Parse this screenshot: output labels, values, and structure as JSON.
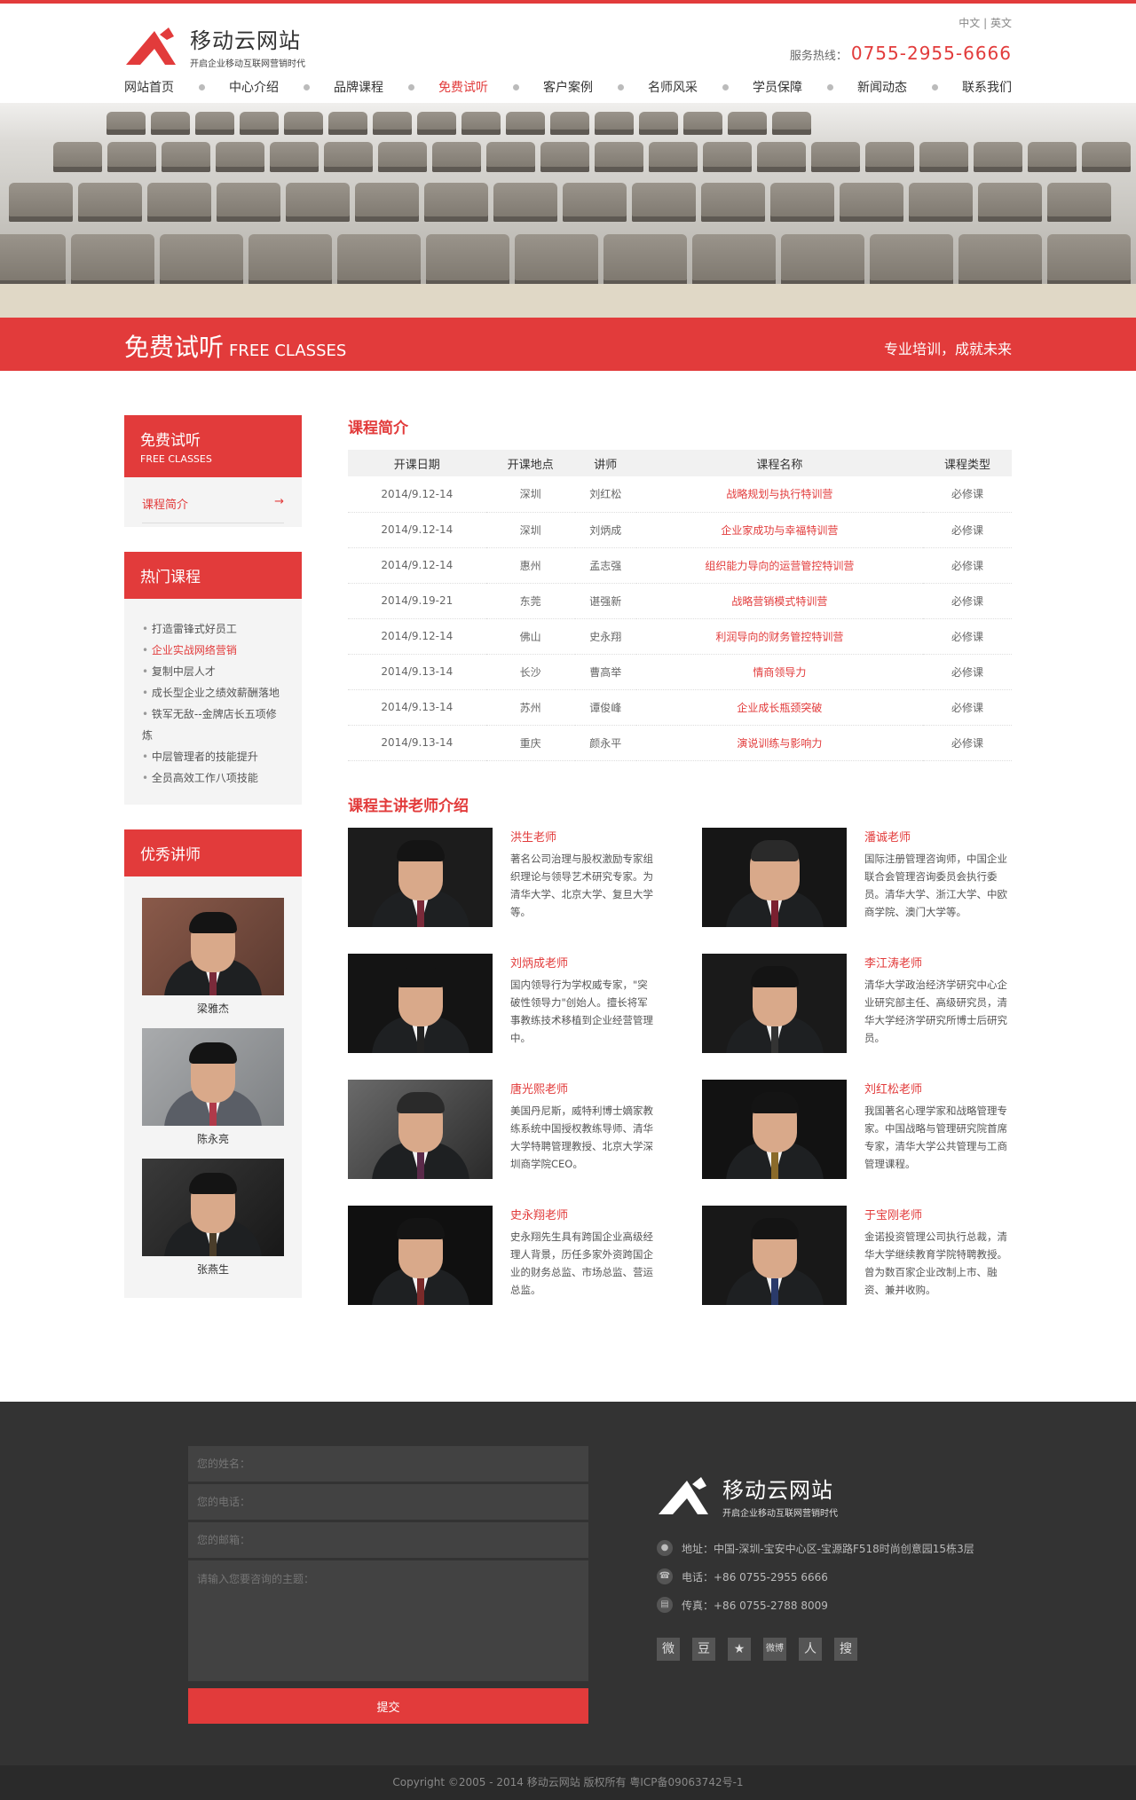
{
  "brand": {
    "name": "移动云网站",
    "slogan": "开启企业移动互联网营销时代"
  },
  "lang": {
    "zh": "中文",
    "sep": "|",
    "en": "英文"
  },
  "hotline": {
    "label": "服务热线：",
    "number": "0755-2955-6666"
  },
  "nav": [
    "网站首页",
    "中心介绍",
    "品牌课程",
    "免费试听",
    "客户案例",
    "名师风采",
    "学员保障",
    "新闻动态",
    "联系我们"
  ],
  "banner": {
    "title_cn": "免费试听",
    "title_en": "FREE CLASSES",
    "slogan": "专业培训，成就未来"
  },
  "sidebar": {
    "section": {
      "cn": "免费试听",
      "en": "FREE CLASSES"
    },
    "submenu": {
      "label": "课程简介",
      "arrow": "→"
    },
    "hot_title": "热门课程",
    "hot_courses": [
      "打造雷锋式好员工",
      "企业实战网络营销",
      "复制中层人才",
      "成长型企业之绩效薪酬落地",
      "铁军无敌--金牌店长五项修炼",
      "中层管理者的技能提升",
      "全员高效工作八项技能"
    ],
    "teachers_title": "优秀讲师",
    "teachers": [
      "梁雅杰",
      "陈永亮",
      "张燕生"
    ]
  },
  "courses": {
    "title": "课程简介",
    "headers": [
      "开课日期",
      "开课地点",
      "讲师",
      "课程名称",
      "课程类型"
    ],
    "rows": [
      [
        "2014/9.12-14",
        "深圳",
        "刘红松",
        "战略规划与执行特训营",
        "必修课"
      ],
      [
        "2014/9.12-14",
        "深圳",
        "刘炳成",
        "企业家成功与幸福特训营",
        "必修课"
      ],
      [
        "2014/9.12-14",
        "惠州",
        "孟志强",
        "组织能力导向的运营管控特训营",
        "必修课"
      ],
      [
        "2014/9.19-21",
        "东莞",
        "谌强新",
        "战略营销模式特训营",
        "必修课"
      ],
      [
        "2014/9.12-14",
        "佛山",
        "史永翔",
        "利润导向的财务管控特训营",
        "必修课"
      ],
      [
        "2014/9.13-14",
        "长沙",
        "曹高举",
        "情商领导力",
        "必修课"
      ],
      [
        "2014/9.13-14",
        "苏州",
        "谭俊峰",
        "企业成长瓶颈突破",
        "必修课"
      ],
      [
        "2014/9.13-14",
        "重庆",
        "颜永平",
        "演说训练与影响力",
        "必修课"
      ]
    ]
  },
  "lecturers": {
    "title": "课程主讲老师介绍",
    "items": [
      {
        "name": "洪生老师",
        "desc": "著名公司治理与股权激励专家组织理论与领导艺术研究专家。为清华大学、北京大学、复旦大学等。"
      },
      {
        "name": "潘诚老师",
        "desc": "国际注册管理咨询师，中国企业联合会管理咨询委员会执行委员。清华大学、浙江大学、中欧商学院、澳门大学等。"
      },
      {
        "name": "刘炳成老师",
        "desc": "国内领导行为学权威专家，\"突破性领导力\"创始人。擅长将军事教练技术移植到企业经营管理中。"
      },
      {
        "name": "李江涛老师",
        "desc": "清华大学政治经济学研究中心企业研究部主任、高级研究员，清华大学经济学研究所博士后研究员。"
      },
      {
        "name": "唐光熙老师",
        "desc": "美国丹尼斯，威特利博士嫡家教练系统中国授权教练导师、清华大学特聘管理教授、北京大学深圳商学院CEO。"
      },
      {
        "name": "刘红松老师",
        "desc": "我国著名心理学家和战略管理专家。中国战略与管理研究院首席专家，清华大学公共管理与工商管理课程。"
      },
      {
        "name": "史永翔老师",
        "desc": "史永翔先生具有跨国企业高级经理人背景，历任多家外资跨国企业的财务总监、市场总监、营运总监。"
      },
      {
        "name": "于宝刚老师",
        "desc": "金诺投资管理公司执行总裁，清华大学继续教育学院特聘教授。曾为数百家企业改制上市、融资、兼并收购。"
      }
    ]
  },
  "form": {
    "name_ph": "您的姓名：",
    "phone_ph": "您的电话：",
    "email_ph": "您的邮箱：",
    "msg_ph": "请输入您要咨询的主题：",
    "submit": "提交"
  },
  "contact": {
    "address": "地址：中国-深圳-宝安中心区-宝源路F518时尚创意园15栋3层",
    "phone": "电话：+86 0755-2955 6666",
    "fax": "传真：+86 0755-2788 8009"
  },
  "social": [
    "微",
    "豆",
    "★",
    "微博",
    "人",
    "搜"
  ],
  "copyright": "Copyright ©2005 - 2014  移动云网站 版权所有     粤ICP备09063742号-1",
  "colors": {
    "accent": "#e23b3b",
    "footer": "#333333"
  }
}
